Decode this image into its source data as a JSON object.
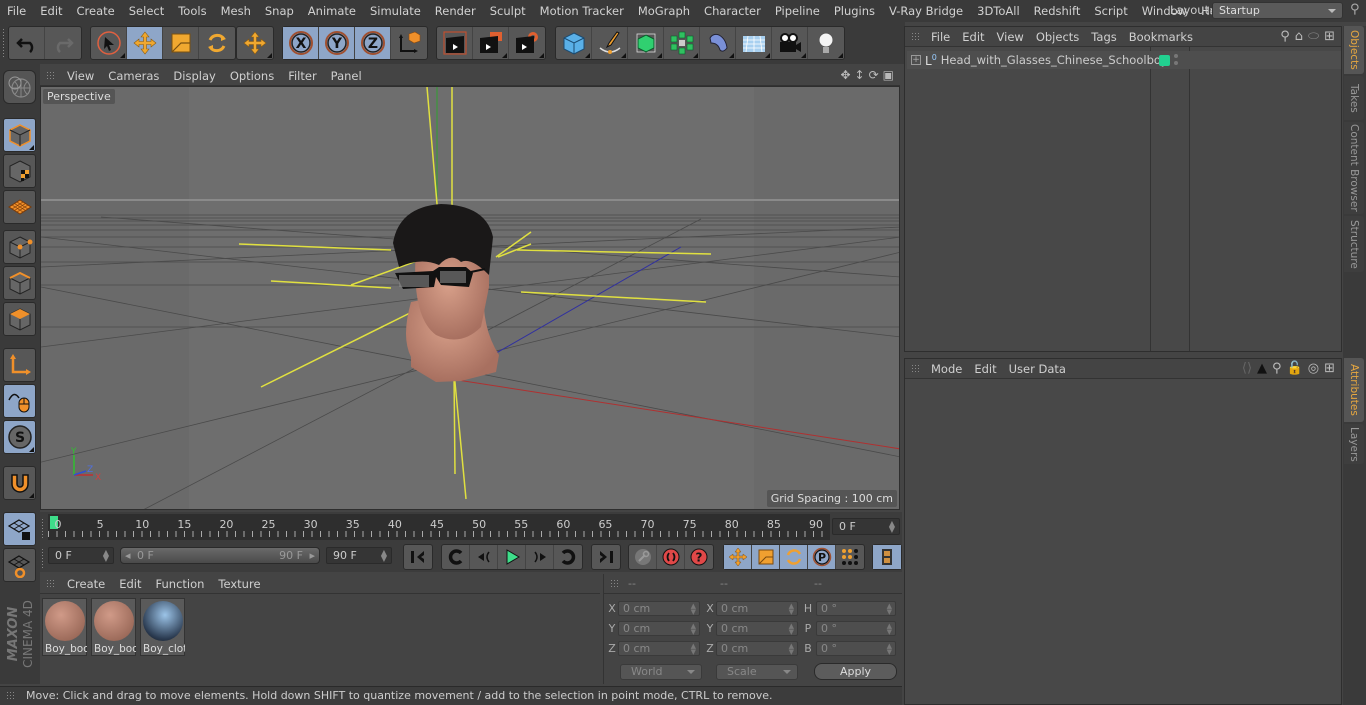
{
  "menubar": {
    "items": [
      "File",
      "Edit",
      "Create",
      "Select",
      "Tools",
      "Mesh",
      "Snap",
      "Animate",
      "Simulate",
      "Render",
      "Sculpt",
      "Motion Tracker",
      "MoGraph",
      "Character",
      "Pipeline",
      "Plugins",
      "V-Ray Bridge",
      "3DToAll",
      "Redshift",
      "Script",
      "Window",
      "Help"
    ],
    "layout_label": "Layout:",
    "layout_value": "Startup"
  },
  "toolbar": {
    "icons": [
      "undo-icon",
      "redo-icon",
      "live-selection-icon",
      "move-icon",
      "scale-icon",
      "rotate-icon",
      "recent-tool-icon",
      "x-axis-lock-icon",
      "y-axis-lock-icon",
      "z-axis-lock-icon",
      "coordinate-system-icon",
      "render-view-icon",
      "render-to-picture-viewer-icon",
      "render-settings-icon",
      "cube-primitive-icon",
      "pen-spline-icon",
      "subdivision-surface-icon",
      "cloner-icon",
      "deformer-icon",
      "floor-icon",
      "camera-icon",
      "light-icon"
    ]
  },
  "viewport": {
    "menu": [
      "View",
      "Cameras",
      "Display",
      "Options",
      "Filter",
      "Panel"
    ],
    "camera_label": "Perspective",
    "grid_spacing": "Grid Spacing : 100 cm",
    "axis_labels": {
      "y": "Y",
      "z": "Z",
      "x": "X"
    }
  },
  "left_toolbar": {
    "icons": [
      "model-mode-icon",
      "texture-mode-icon",
      "workplane-mode-icon",
      "points-mode-icon",
      "edges-mode-icon",
      "polygons-mode-icon",
      "axis-mode-icon",
      "tweak-mode-icon",
      "solo-mode-icon",
      "snap-magnet-icon",
      "workplane-lock-icon",
      "workplane-rotate-icon"
    ]
  },
  "timeline": {
    "ticks": [
      "0",
      "5",
      "10",
      "15",
      "20",
      "25",
      "30",
      "35",
      "40",
      "45",
      "50",
      "55",
      "60",
      "65",
      "70",
      "75",
      "80",
      "85",
      "90"
    ],
    "current_frame": "0 F",
    "start_frame": "0 F",
    "range_start": "0 F",
    "range_end": "90 F",
    "end_frame": "90 F"
  },
  "transport": {
    "icons": [
      "go-to-start-icon",
      "previous-key-icon",
      "previous-frame-icon",
      "play-icon",
      "next-frame-icon",
      "next-key-icon",
      "go-to-end-icon",
      "record-keys-icon",
      "autokey-icon",
      "keyframe-selection-icon",
      "position-key-icon",
      "scale-key-icon",
      "rotation-key-icon",
      "parameter-key-icon",
      "pla-key-icon",
      "timeline-icon"
    ]
  },
  "materials": {
    "menu": [
      "Create",
      "Edit",
      "Function",
      "Texture"
    ],
    "items": [
      {
        "label": "Boy_boc",
        "color": "#b07a6a"
      },
      {
        "label": "Boy_boc",
        "color": "#b07a6a"
      },
      {
        "label": "Boy_clot",
        "color": "#6a90b8"
      }
    ]
  },
  "coordinates": {
    "headers": [
      "--",
      "--",
      "--"
    ],
    "position": {
      "x": "0 cm",
      "y": "0 cm",
      "z": "0 cm"
    },
    "size": {
      "x": "0 cm",
      "y": "0 cm",
      "z": "0 cm"
    },
    "rotation": {
      "h": "0 °",
      "p": "0 °",
      "b": "0 °"
    },
    "labels": {
      "x": "X",
      "y": "Y",
      "z": "Z",
      "h": "H",
      "p": "P",
      "b": "B"
    },
    "mode_dropdown": "World",
    "scale_dropdown": "Scale",
    "apply_label": "Apply"
  },
  "status": {
    "text": "Move: Click and drag to move elements. Hold down SHIFT to quantize movement / add to the selection in point mode, CTRL to remove."
  },
  "objects_panel": {
    "menu": [
      "File",
      "Edit",
      "View",
      "Objects",
      "Tags",
      "Bookmarks"
    ],
    "objects": [
      {
        "name": "Head_with_Glasses_Chinese_Schoolboy",
        "layer_color": "#22d090"
      }
    ]
  },
  "attributes_panel": {
    "menu": [
      "Mode",
      "Edit",
      "User Data"
    ]
  },
  "side_tabs": {
    "top": [
      {
        "label": "Objects",
        "active": true
      },
      {
        "label": "Takes",
        "active": false
      },
      {
        "label": "Content Browser",
        "active": false
      },
      {
        "label": "Structure",
        "active": false
      }
    ],
    "bottom": [
      {
        "label": "Attributes",
        "active": true
      },
      {
        "label": "Layers",
        "active": false
      }
    ]
  },
  "branding": {
    "maxon": "MAXON",
    "product": "CINEMA 4D"
  },
  "colors": {
    "accent_blue": "#8ea6c8",
    "orange": "#f0a030",
    "active_tab": "#e8a840",
    "layer_green": "#22d090"
  }
}
